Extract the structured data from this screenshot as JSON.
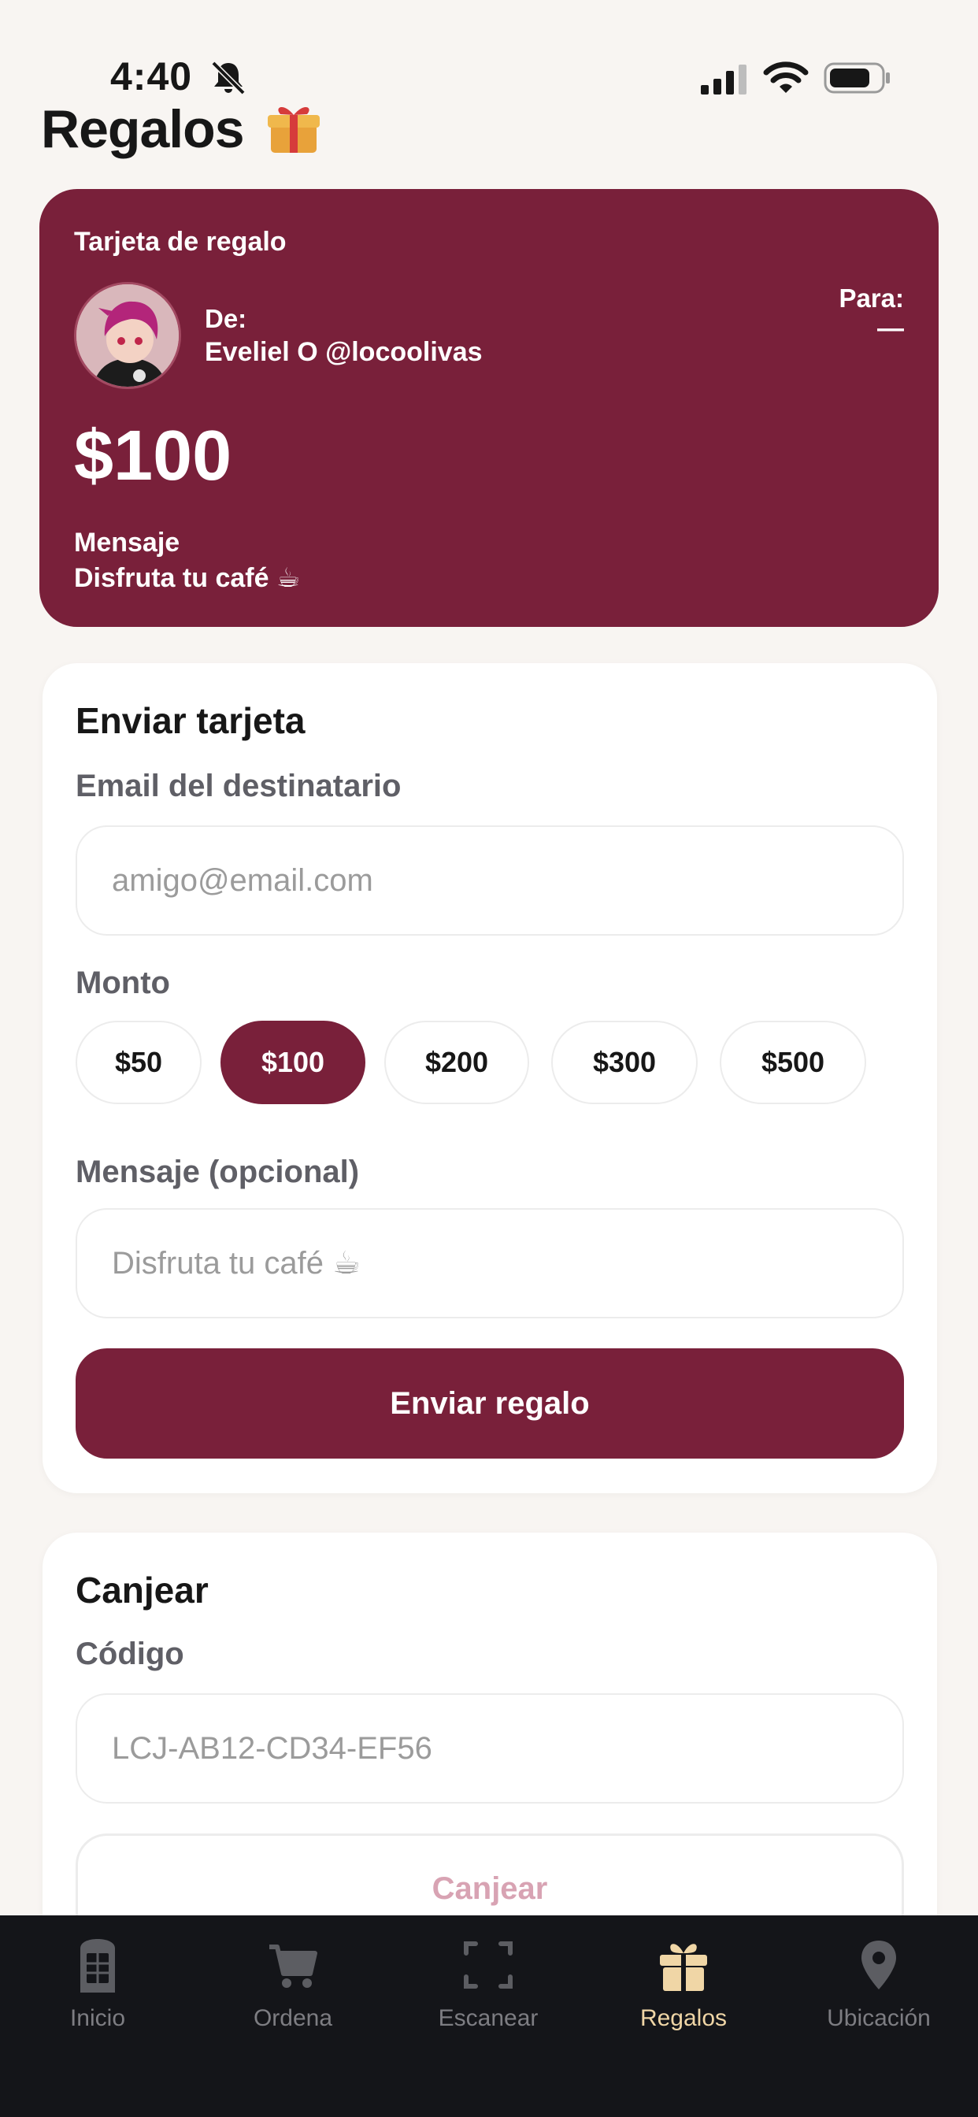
{
  "status_bar": {
    "time": "4:40"
  },
  "header": {
    "title": "Regalos",
    "emoji": "gift-icon"
  },
  "gift_card": {
    "title": "Tarjeta de regalo",
    "from_label": "De:",
    "from_value": "Eveliel O @locoolivas",
    "to_label": "Para:",
    "to_value": "—",
    "amount": "$100",
    "message_label": "Mensaje",
    "message_value": "Disfruta tu café ☕"
  },
  "send_card": {
    "title": "Enviar tarjeta",
    "email_label": "Email del destinatario",
    "email_placeholder": "amigo@email.com",
    "amount_label": "Monto",
    "amounts": [
      "$50",
      "$100",
      "$200",
      "$300",
      "$500"
    ],
    "selected_amount": "$100",
    "message_label": "Mensaje (opcional)",
    "message_placeholder": "Disfruta tu café ☕",
    "submit_label": "Enviar regalo"
  },
  "redeem_card": {
    "title": "Canjear",
    "code_label": "Código",
    "code_placeholder": "LCJ-AB12-CD34-EF56",
    "submit_label": "Canjear"
  },
  "tab_bar": {
    "tabs": [
      {
        "label": "Inicio",
        "icon": "phone-booth-icon"
      },
      {
        "label": "Ordena",
        "icon": "cart-icon"
      },
      {
        "label": "Escanear",
        "icon": "scan-icon"
      },
      {
        "label": "Regalos",
        "icon": "gift-icon"
      },
      {
        "label": "Ubicación",
        "icon": "location-pin-icon"
      }
    ],
    "active": "Regalos"
  },
  "colors": {
    "brand": "#79203a",
    "background": "#f8f5f2",
    "tab_bar": "#141519",
    "tab_active": "#f0d6a6",
    "disabled_text": "#d8a3b3"
  }
}
